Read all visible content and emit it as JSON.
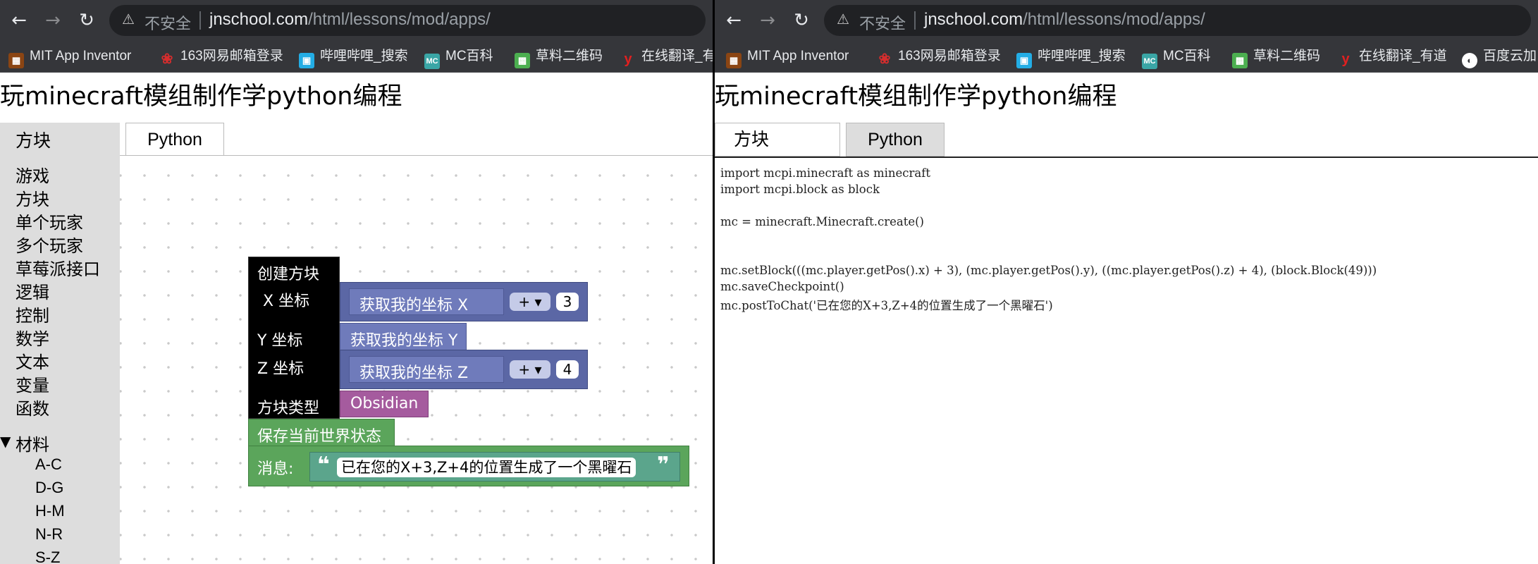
{
  "browser": {
    "nav": {
      "back": "←",
      "forward": "→",
      "reload": "↻"
    },
    "security_icon": "⚠",
    "insecure_label": "不安全",
    "url_host": "jnschool.com",
    "url_path": "/html/lessons/mod/apps/"
  },
  "bookmarks": [
    {
      "label": "MIT App Inventor",
      "icon": "mit-app-inventor-icon",
      "color": "#8b4513"
    },
    {
      "label": "163网易邮箱登录",
      "icon": "netease-mail-icon",
      "color": "#d62d2d"
    },
    {
      "label": "哔哩哔哩_搜索",
      "icon": "bilibili-icon",
      "color": "#23ade5"
    },
    {
      "label": "MC百科",
      "icon": "mc-wiki-icon",
      "color": "#3aa6a6"
    },
    {
      "label": "草料二维码",
      "icon": "qrcode-icon",
      "color": "#4caf50"
    },
    {
      "label": "在线翻译_有道",
      "icon": "youdao-icon",
      "color": "#e02020"
    },
    {
      "label": "百度云加",
      "icon": "baidu-cloud-icon",
      "color": "#ffffff"
    }
  ],
  "left_bookmarks_last": "在线翻译_有",
  "page_title": "玩minecraft模组制作学python编程",
  "tabs": {
    "blocks": "方块",
    "python": "Python"
  },
  "sidebar": {
    "categories": [
      "游戏",
      "方块",
      "单个玩家",
      "多个玩家",
      "草莓派接口",
      "逻辑",
      "控制",
      "数学",
      "文本",
      "变量",
      "函数"
    ],
    "materials": {
      "label": "材料",
      "toggle": "▼",
      "items": [
        "A-C",
        "D-G",
        "H-M",
        "N-R",
        "S-Z"
      ]
    }
  },
  "blocks": {
    "create_block": "创建方块",
    "x_label": "X 坐标",
    "y_label": "Y 坐标",
    "z_label": "Z 坐标",
    "get_pos_x": "获取我的坐标 X",
    "get_pos_y": "获取我的坐标 Y",
    "get_pos_z": "获取我的坐标 Z",
    "op_plus": "+ ▾",
    "x_offset": "3",
    "z_offset": "4",
    "block_type_label": "方块类型",
    "block_type_value": "Obsidian",
    "save_checkpoint": "保存当前世界状态",
    "message_label": "消息:",
    "message_text": "已在您的X+3,Z+4的位置生成了一个黑曜石",
    "quote_open": "❝",
    "quote_close": "❞"
  },
  "code_lines": [
    "import mcpi.minecraft as minecraft",
    "import mcpi.block as block",
    "",
    "mc = minecraft.Minecraft.create()",
    "",
    "",
    "mc.setBlock(((mc.player.getPos().x) + 3), (mc.player.getPos().y), ((mc.player.getPos().z) + 4), (block.Block(49)))",
    "mc.saveCheckpoint()",
    "mc.postToChat('已在您的X+3,Z+4的位置生成了一个黑曜石')"
  ]
}
